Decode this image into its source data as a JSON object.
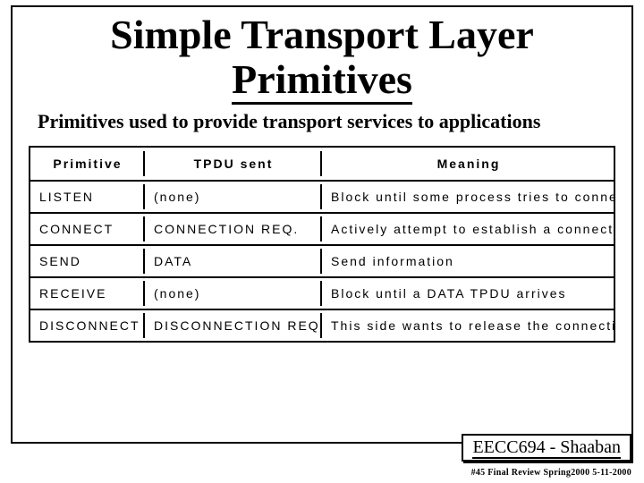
{
  "title_line1": "Simple Transport Layer",
  "title_line2": "Primitives",
  "subtitle": "Primitives used to provide transport services to applications",
  "table": {
    "headers": {
      "c1": "Primitive",
      "c2": "TPDU sent",
      "c3": "Meaning"
    },
    "rows": [
      {
        "c1": "LISTEN",
        "c2": "(none)",
        "c3": "Block until some process tries to connect"
      },
      {
        "c1": "CONNECT",
        "c2": "CONNECTION REQ.",
        "c3": "Actively attempt to establish a connection"
      },
      {
        "c1": "SEND",
        "c2": "DATA",
        "c3": "Send information"
      },
      {
        "c1": "RECEIVE",
        "c2": "(none)",
        "c3": "Block until a DATA TPDU arrives"
      },
      {
        "c1": "DISCONNECT",
        "c2": "DISCONNECTION REQ.",
        "c3": "This side wants to release the connection"
      }
    ]
  },
  "footer_box": "EECC694 - Shaaban",
  "footer_small": "#45  Final Review   Spring2000   5-11-2000"
}
